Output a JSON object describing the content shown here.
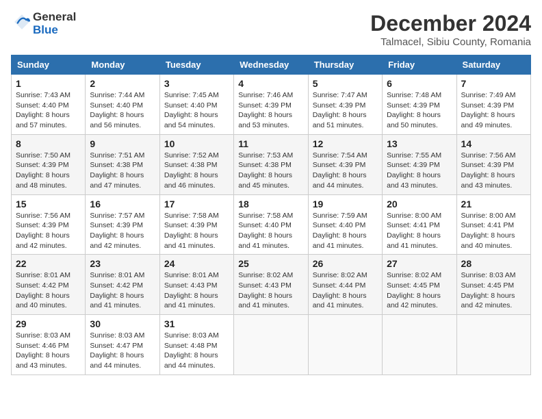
{
  "header": {
    "logo": {
      "line1": "General",
      "line2": "Blue"
    },
    "title": "December 2024",
    "location": "Talmacel, Sibiu County, Romania"
  },
  "weekdays": [
    "Sunday",
    "Monday",
    "Tuesday",
    "Wednesday",
    "Thursday",
    "Friday",
    "Saturday"
  ],
  "weeks": [
    [
      {
        "day": "1",
        "sunrise": "7:43 AM",
        "sunset": "4:40 PM",
        "daylight": "8 hours and 57 minutes."
      },
      {
        "day": "2",
        "sunrise": "7:44 AM",
        "sunset": "4:40 PM",
        "daylight": "8 hours and 56 minutes."
      },
      {
        "day": "3",
        "sunrise": "7:45 AM",
        "sunset": "4:40 PM",
        "daylight": "8 hours and 54 minutes."
      },
      {
        "day": "4",
        "sunrise": "7:46 AM",
        "sunset": "4:39 PM",
        "daylight": "8 hours and 53 minutes."
      },
      {
        "day": "5",
        "sunrise": "7:47 AM",
        "sunset": "4:39 PM",
        "daylight": "8 hours and 51 minutes."
      },
      {
        "day": "6",
        "sunrise": "7:48 AM",
        "sunset": "4:39 PM",
        "daylight": "8 hours and 50 minutes."
      },
      {
        "day": "7",
        "sunrise": "7:49 AM",
        "sunset": "4:39 PM",
        "daylight": "8 hours and 49 minutes."
      }
    ],
    [
      {
        "day": "8",
        "sunrise": "7:50 AM",
        "sunset": "4:39 PM",
        "daylight": "8 hours and 48 minutes."
      },
      {
        "day": "9",
        "sunrise": "7:51 AM",
        "sunset": "4:38 PM",
        "daylight": "8 hours and 47 minutes."
      },
      {
        "day": "10",
        "sunrise": "7:52 AM",
        "sunset": "4:38 PM",
        "daylight": "8 hours and 46 minutes."
      },
      {
        "day": "11",
        "sunrise": "7:53 AM",
        "sunset": "4:38 PM",
        "daylight": "8 hours and 45 minutes."
      },
      {
        "day": "12",
        "sunrise": "7:54 AM",
        "sunset": "4:39 PM",
        "daylight": "8 hours and 44 minutes."
      },
      {
        "day": "13",
        "sunrise": "7:55 AM",
        "sunset": "4:39 PM",
        "daylight": "8 hours and 43 minutes."
      },
      {
        "day": "14",
        "sunrise": "7:56 AM",
        "sunset": "4:39 PM",
        "daylight": "8 hours and 43 minutes."
      }
    ],
    [
      {
        "day": "15",
        "sunrise": "7:56 AM",
        "sunset": "4:39 PM",
        "daylight": "8 hours and 42 minutes."
      },
      {
        "day": "16",
        "sunrise": "7:57 AM",
        "sunset": "4:39 PM",
        "daylight": "8 hours and 42 minutes."
      },
      {
        "day": "17",
        "sunrise": "7:58 AM",
        "sunset": "4:39 PM",
        "daylight": "8 hours and 41 minutes."
      },
      {
        "day": "18",
        "sunrise": "7:58 AM",
        "sunset": "4:40 PM",
        "daylight": "8 hours and 41 minutes."
      },
      {
        "day": "19",
        "sunrise": "7:59 AM",
        "sunset": "4:40 PM",
        "daylight": "8 hours and 41 minutes."
      },
      {
        "day": "20",
        "sunrise": "8:00 AM",
        "sunset": "4:41 PM",
        "daylight": "8 hours and 41 minutes."
      },
      {
        "day": "21",
        "sunrise": "8:00 AM",
        "sunset": "4:41 PM",
        "daylight": "8 hours and 40 minutes."
      }
    ],
    [
      {
        "day": "22",
        "sunrise": "8:01 AM",
        "sunset": "4:42 PM",
        "daylight": "8 hours and 40 minutes."
      },
      {
        "day": "23",
        "sunrise": "8:01 AM",
        "sunset": "4:42 PM",
        "daylight": "8 hours and 41 minutes."
      },
      {
        "day": "24",
        "sunrise": "8:01 AM",
        "sunset": "4:43 PM",
        "daylight": "8 hours and 41 minutes."
      },
      {
        "day": "25",
        "sunrise": "8:02 AM",
        "sunset": "4:43 PM",
        "daylight": "8 hours and 41 minutes."
      },
      {
        "day": "26",
        "sunrise": "8:02 AM",
        "sunset": "4:44 PM",
        "daylight": "8 hours and 41 minutes."
      },
      {
        "day": "27",
        "sunrise": "8:02 AM",
        "sunset": "4:45 PM",
        "daylight": "8 hours and 42 minutes."
      },
      {
        "day": "28",
        "sunrise": "8:03 AM",
        "sunset": "4:45 PM",
        "daylight": "8 hours and 42 minutes."
      }
    ],
    [
      {
        "day": "29",
        "sunrise": "8:03 AM",
        "sunset": "4:46 PM",
        "daylight": "8 hours and 43 minutes."
      },
      {
        "day": "30",
        "sunrise": "8:03 AM",
        "sunset": "4:47 PM",
        "daylight": "8 hours and 44 minutes."
      },
      {
        "day": "31",
        "sunrise": "8:03 AM",
        "sunset": "4:48 PM",
        "daylight": "8 hours and 44 minutes."
      },
      null,
      null,
      null,
      null
    ]
  ],
  "labels": {
    "sunrise": "Sunrise:",
    "sunset": "Sunset:",
    "daylight": "Daylight:"
  }
}
